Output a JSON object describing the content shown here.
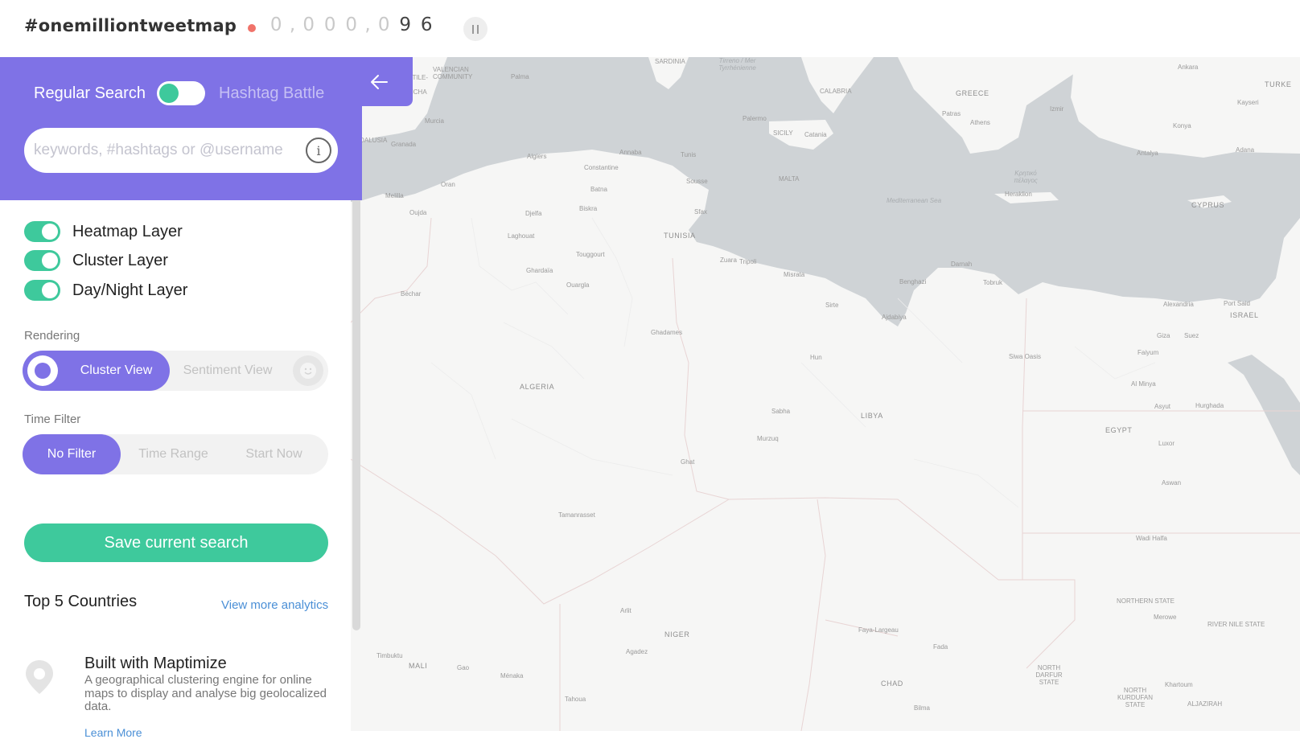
{
  "header": {
    "brand": "#onemilliontweetmap",
    "counter_digits": [
      "0",
      ",",
      "0",
      "0",
      "0",
      ",",
      "0",
      "9",
      "6"
    ],
    "pause_icon": "pause-icon"
  },
  "search": {
    "mode_regular": "Regular Search",
    "mode_hashtag": "Hashtag Battle",
    "placeholder": "keywords, #hashtags or @username",
    "value": ""
  },
  "layers": [
    {
      "label": "Heatmap Layer",
      "on": true
    },
    {
      "label": "Cluster Layer",
      "on": true
    },
    {
      "label": "Day/Night Layer",
      "on": true
    }
  ],
  "rendering": {
    "label": "Rendering",
    "options": [
      "Cluster View",
      "Sentiment View"
    ],
    "selected": "Cluster View"
  },
  "time_filter": {
    "label": "Time Filter",
    "options": [
      "No Filter",
      "Time Range",
      "Start Now"
    ],
    "selected": "No Filter"
  },
  "save_button": "Save current search",
  "top5": {
    "title": "Top 5 Countries",
    "link": "View more analytics"
  },
  "promo": {
    "title": "Built with Maptimize",
    "desc": "A geographical clustering engine for online maps to display and analyse big geolocalized data.",
    "link": "Learn More"
  },
  "map_labels": {
    "countries": [
      "ALGERIA",
      "LIBYA",
      "EGYPT",
      "TUNISIA",
      "NIGER",
      "MALI",
      "CHAD",
      "CYPRUS",
      "ISRAEL",
      "GREECE",
      "TURKE"
    ],
    "regions": [
      "SICILY",
      "CALABRIA",
      "SARDINIA",
      "MALTA",
      "ANDALUSIA",
      "NORTHERN STATE",
      "RIVER NILE STATE",
      "NORTH DARFUR STATE",
      "NORTH KURDUFAN STATE",
      "ALJAZIRAH",
      "VALENCIAN COMMUNITY",
      "CASTILE-LA MANCHA"
    ],
    "seas": [
      "Mediterranean Sea",
      "Tirreno / Mer Tyrrhénienne",
      "Κρητικό πέλαγος"
    ],
    "cities": [
      "Algiers",
      "Oran",
      "Constantine",
      "Annaba",
      "Tunis",
      "Sousse",
      "Sfax",
      "Batna",
      "Biskra",
      "Djelfa",
      "Laghouat",
      "Touggourt",
      "Ghardaïa",
      "Ouargla",
      "Béchar",
      "Oujda",
      "Melilla",
      "Granada",
      "Murcia",
      "Palma",
      "Palermo",
      "Catania",
      "Athens",
      "Patras",
      "Heraklion",
      "Izmir",
      "Antalya",
      "Konya",
      "Ankara",
      "Kayseri",
      "Adana",
      "Zuara",
      "Tripoli",
      "Misrata",
      "Benghazi",
      "Darnah",
      "Tobruk",
      "Sirte",
      "Ajdabiya",
      "Alexandria",
      "Port Said",
      "Giza",
      "Suez",
      "Faiyum",
      "Siwa Oasis",
      "Al Minya",
      "Asyut",
      "Hurghada",
      "Luxor",
      "Aswan",
      "Wadi Halfa",
      "Hun",
      "Sabha",
      "Murzuq",
      "Ghat",
      "Ghadames",
      "Tamanrasset",
      "Arlit",
      "Agadez",
      "Faya-Largeau",
      "Fada",
      "Timbuktu",
      "Gao",
      "Ménaka",
      "Tahoua",
      "Merowe",
      "Khartoum",
      "Bilma"
    ]
  },
  "colors": {
    "accent": "#7f72e6",
    "green": "#3ec99c",
    "water": "#cfd3d6",
    "land": "#f6f6f5"
  }
}
